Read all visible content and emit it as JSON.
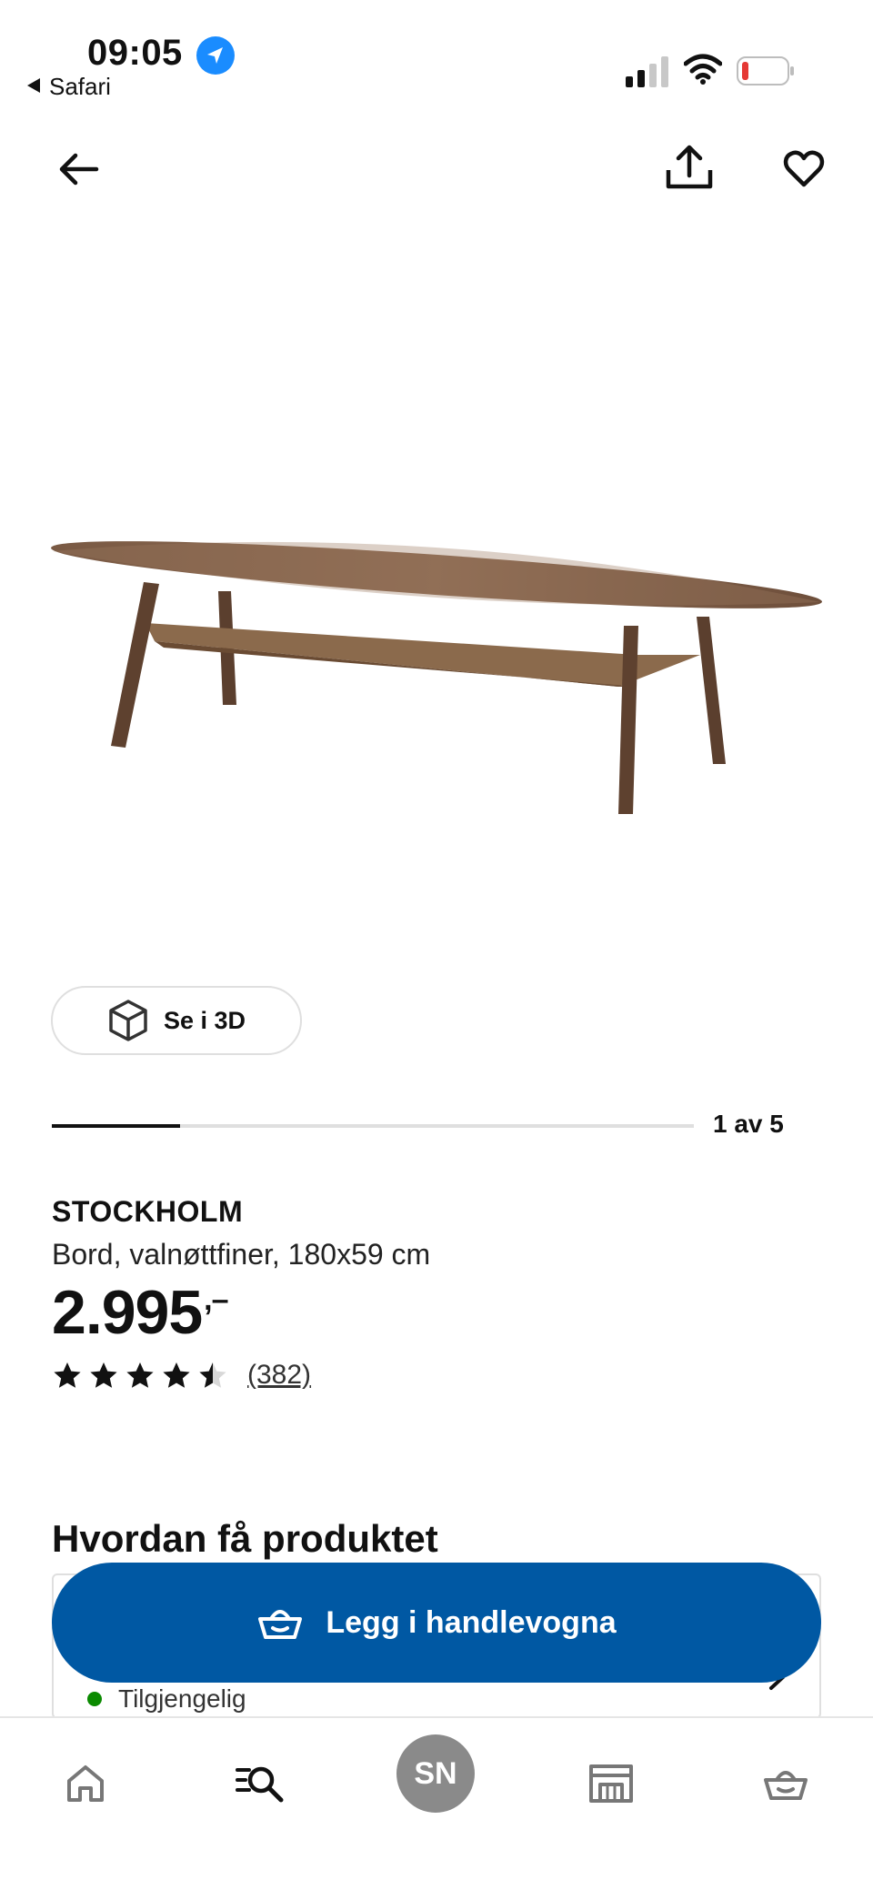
{
  "status_bar": {
    "time": "09:05",
    "back_app": "Safari"
  },
  "gallery": {
    "btn_3d_label": "Se i 3D",
    "progress_label": "1 av 5",
    "progress_fraction": 0.2
  },
  "product": {
    "name": "STOCKHOLM",
    "description": "Bord, valnøttfiner, 180x59 cm",
    "price": "2.995",
    "price_suffix": ",–",
    "rating": 4.5,
    "review_count": "(382)"
  },
  "delivery": {
    "section_title": "Hvordan få produktet",
    "availability": "Tilgjengelig"
  },
  "cta": {
    "label": "Legg i handlevogna"
  },
  "bottom_nav": {
    "avatar_initials": "SN"
  },
  "colors": {
    "primary": "#0058a3",
    "available": "#0a8a00",
    "battery_low": "#e53935"
  },
  "icons": [
    "back-arrow-icon",
    "share-icon",
    "heart-icon",
    "cube-3d-icon",
    "star-icon",
    "basket-icon",
    "home-icon",
    "search-icon",
    "store-icon",
    "cart-icon",
    "chevron-right-icon",
    "location-arrow-icon",
    "signal-icon",
    "wifi-icon",
    "battery-icon"
  ]
}
